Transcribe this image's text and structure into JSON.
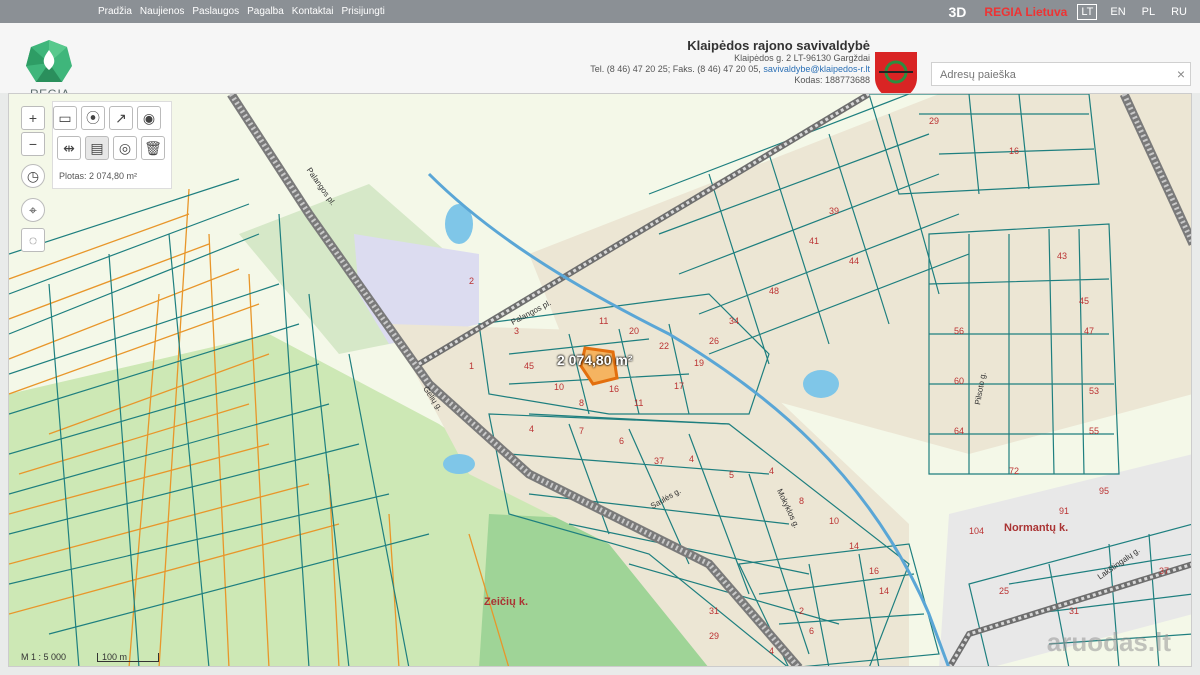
{
  "nav": [
    "Pradžia",
    "Naujienos",
    "Paslaugos",
    "Pagalba",
    "Kontaktai",
    "Prisijungti"
  ],
  "topright": {
    "btn3d": "3D",
    "regia": "REGIA Lietuva",
    "langs": [
      "LT",
      "EN",
      "PL",
      "RU"
    ]
  },
  "logo": {
    "text": "REGIA"
  },
  "municipality": {
    "title": "Klaipėdos rajono savivaldybė",
    "address": "Klaipėdos g. 2 LT-96130 Gargždai",
    "phone": "Tel. (8 46) 47 20 25; Faks. (8 46) 47 20 05,",
    "email": "savivaldybe@klaipedos-r.lt",
    "code": "Kodas: 188773688"
  },
  "search": {
    "placeholder": "Adresų paieška",
    "clear": "×"
  },
  "map": {
    "area_label": "Plotas: 2 074,80 m²",
    "measure": "2 074,80 m²",
    "scale": "M 1 : 5 000",
    "scalebar": "100 m",
    "places": [
      "Normantų k.",
      "Zeičių k."
    ],
    "streets": [
      "Palangos pl.",
      "Palangos pl.",
      "Pilsoto g.",
      "Gėlių g.",
      "Mokyklos g.",
      "Saulės g.",
      "Lakštingalų g."
    ],
    "watermark": "aruodas.lt"
  },
  "colors": {
    "parcel": "#1e7f7f",
    "orange": "#e8962a",
    "road": "#7a7a7a",
    "river": "#5aa6d6"
  }
}
